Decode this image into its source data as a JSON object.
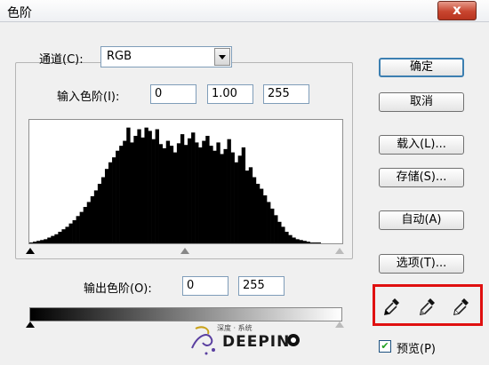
{
  "window": {
    "title": "色阶",
    "close_label": "x"
  },
  "channel": {
    "label": "通道(C):",
    "value": "RGB"
  },
  "input_levels": {
    "label": "输入色阶(I):",
    "black": "0",
    "gamma": "1.00",
    "white": "255"
  },
  "output_levels": {
    "label": "输出色阶(O):",
    "black": "0",
    "white": "255"
  },
  "buttons": {
    "ok": "确定",
    "cancel": "取消",
    "load": "载入(L)...",
    "save": "存储(S)...",
    "auto": "自动(A)",
    "options": "选项(T)..."
  },
  "preview": {
    "label": "预览(P)",
    "checked": true
  },
  "watermark": {
    "brand": "DEEPIN",
    "tagline": "深度 · 系统"
  },
  "histogram": {
    "values": [
      1,
      2,
      3,
      4,
      5,
      7,
      9,
      11,
      14,
      17,
      20,
      24,
      28,
      33,
      38,
      44,
      50,
      57,
      64,
      72,
      80,
      90,
      98,
      104,
      112,
      118,
      124,
      128,
      122,
      130,
      135,
      128,
      140,
      132,
      126,
      138,
      120,
      115,
      124,
      118,
      110,
      121,
      126,
      119,
      127,
      130,
      122,
      116,
      124,
      128,
      118,
      112,
      122,
      108,
      114,
      104,
      110,
      98,
      106,
      94,
      88,
      92,
      80,
      72,
      66,
      58,
      50,
      42,
      34,
      26,
      20,
      14,
      10,
      7,
      5,
      4,
      3,
      2,
      1,
      1,
      1,
      0,
      0,
      0,
      0,
      0,
      0
    ],
    "spikes": [
      {
        "i": 27,
        "h": 140
      },
      {
        "i": 30,
        "h": 138
      },
      {
        "i": 33,
        "h": 136
      },
      {
        "i": 42,
        "h": 132
      },
      {
        "i": 45,
        "h": 134
      },
      {
        "i": 49,
        "h": 130
      },
      {
        "i": 55,
        "h": 126
      },
      {
        "i": 59,
        "h": 116
      }
    ]
  }
}
